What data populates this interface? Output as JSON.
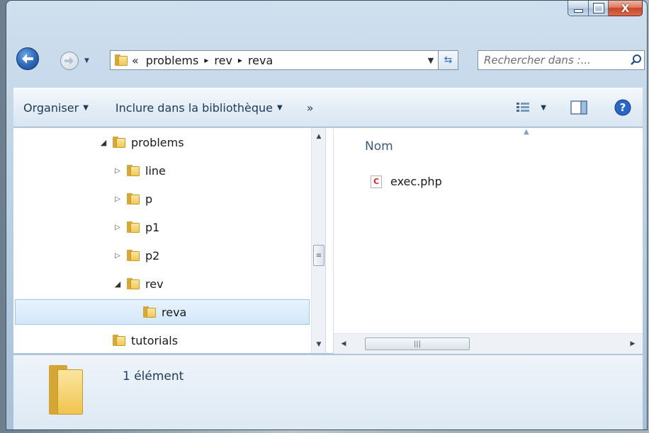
{
  "window": {
    "controls": {
      "minimize": "",
      "maximize": "",
      "close": "X"
    }
  },
  "navigation": {
    "address": {
      "overflow": "«",
      "crumbs": [
        "problems",
        "rev",
        "reva"
      ],
      "separator": "▸"
    },
    "search": {
      "placeholder": "Rechercher dans :..."
    }
  },
  "toolbar": {
    "organize_label": "Organiser",
    "include_label": "Inclure dans la bibliothèque",
    "more_label": "»"
  },
  "tree": {
    "items": [
      {
        "label": "problems",
        "expander": "◢",
        "level": 0
      },
      {
        "label": "line",
        "expander": "▷",
        "level": 1
      },
      {
        "label": "p",
        "expander": "▷",
        "level": 1
      },
      {
        "label": "p1",
        "expander": "▷",
        "level": 1
      },
      {
        "label": "p2",
        "expander": "▷",
        "level": 1
      },
      {
        "label": "rev",
        "expander": "◢",
        "level": 1
      },
      {
        "label": "reva",
        "expander": "",
        "level": 2,
        "selected": true
      },
      {
        "label": "tutorials",
        "expander": "",
        "level": 0
      }
    ]
  },
  "content": {
    "column_header": "Nom",
    "files": [
      {
        "name": "exec.php",
        "icon": "php-file-icon"
      }
    ]
  },
  "details": {
    "count_text": "1 élément"
  },
  "colors": {
    "selection": "#d2e7fb",
    "toolbar_text": "#1e3a5a",
    "back_button": "#2a66b8"
  }
}
